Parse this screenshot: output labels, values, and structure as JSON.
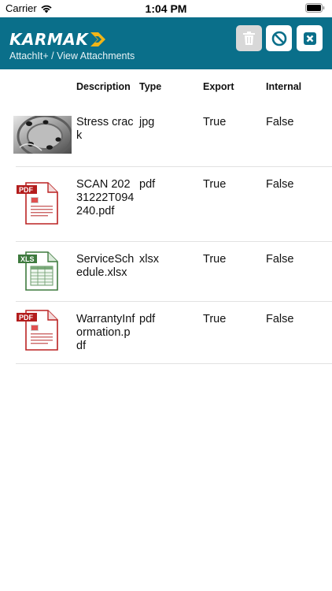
{
  "status_bar": {
    "carrier": "Carrier",
    "time": "1:04 PM"
  },
  "header": {
    "logo": "KARMAK",
    "breadcrumb": "AttachIt+ / View Attachments",
    "buttons": {
      "delete": "trash-icon",
      "cancel": "block-icon",
      "close": "close-icon"
    }
  },
  "table": {
    "columns": [
      "Description",
      "Type",
      "Export",
      "Internal"
    ],
    "rows": [
      {
        "thumbnail": "photo",
        "description": "Stress crack",
        "type": "jpg",
        "export": "True",
        "internal": "False"
      },
      {
        "thumbnail": "pdf-icon",
        "description": "SCAN 20231222T094240.pdf",
        "type": "pdf",
        "export": "True",
        "internal": "False"
      },
      {
        "thumbnail": "xls-icon",
        "description": "ServiceSchedule.xlsx",
        "type": "xlsx",
        "export": "True",
        "internal": "False"
      },
      {
        "thumbnail": "pdf-icon",
        "description": "WarrantyInformation.pdf",
        "type": "pdf",
        "export": "True",
        "internal": "False"
      }
    ]
  },
  "colors": {
    "header_bg": "#0a6f8a",
    "logo_accent": "#f2b517"
  },
  "thumb_labels": {
    "pdf": "PDF",
    "xls": "XLS"
  }
}
